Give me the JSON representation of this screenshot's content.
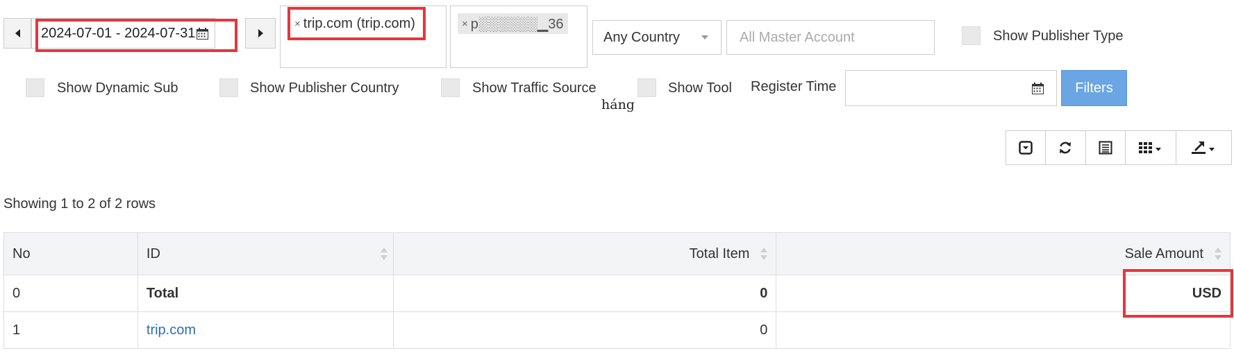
{
  "date_range": {
    "value": "2024-07-01 - 2024-07-31"
  },
  "selected_tags_1": [
    {
      "label": "trip.com (trip.com)"
    }
  ],
  "selected_tags_2": [
    {
      "label": "p░░░░░░▁36"
    }
  ],
  "country_select": {
    "value": "Any Country"
  },
  "master_account": {
    "placeholder": "All Master Account"
  },
  "options": {
    "show_publisher_type": "Show Publisher Type",
    "show_dynamic_sub": "Show Dynamic Sub",
    "show_publisher_country": "Show Publisher Country",
    "show_traffic_source": "Show Traffic Source",
    "show_tool": "Show Tool"
  },
  "stray_text": "háng",
  "register_time": {
    "label": "Register Time",
    "value": ""
  },
  "filters_button": "Filters",
  "toolbar_icons": [
    "toggle-icon",
    "refresh-icon",
    "list-view-icon",
    "columns-icon",
    "export-icon"
  ],
  "pagination_info": "Showing 1 to 2 of 2 rows",
  "table": {
    "headers": {
      "no": "No",
      "id": "ID",
      "total_item": "Total Item",
      "sale_amount": "Sale Amount"
    },
    "rows": [
      {
        "no": "0",
        "id": "Total",
        "total_item": "0",
        "sale_amount": "USD"
      },
      {
        "no": "1",
        "id": "trip.com",
        "total_item": "0",
        "sale_amount": ""
      }
    ]
  },
  "colors": {
    "highlight": "#e8353a",
    "filters_button": "#6aa5e4",
    "link": "#2a6db5"
  }
}
